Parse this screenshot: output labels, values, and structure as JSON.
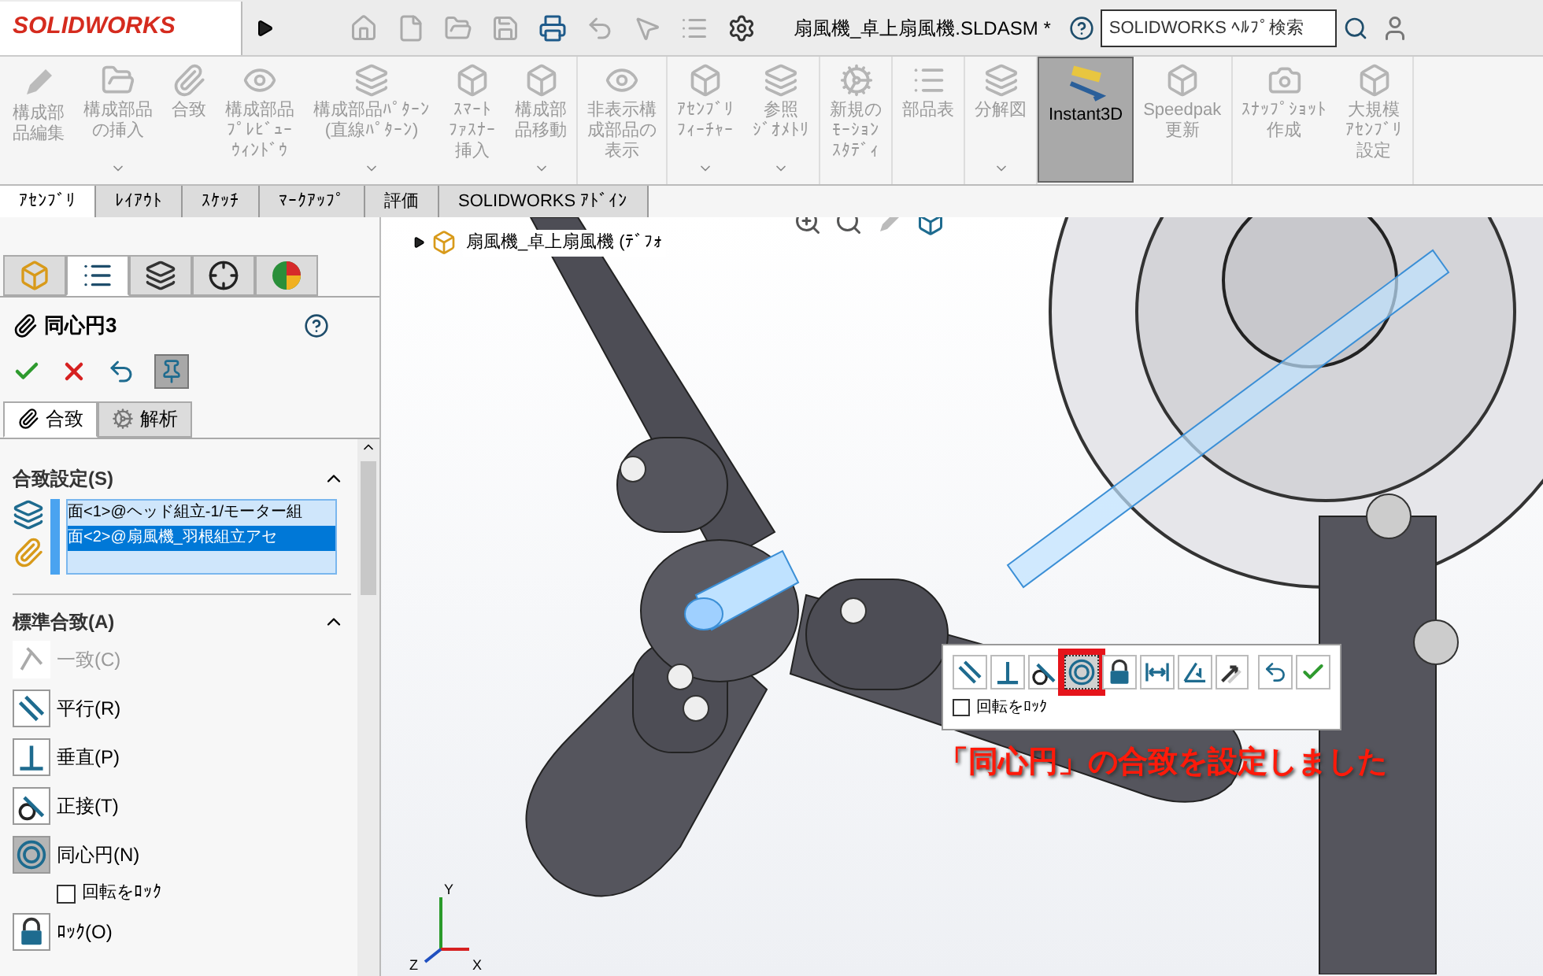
{
  "app_header": {
    "logo": "SOLIDWORKS",
    "title": "扇風機_卓上扇風機.SLDASM *",
    "search": {
      "placeholder": "SOLIDWORKS ﾍﾙﾌﾟ検索"
    }
  },
  "ribbon": {
    "groups": [
      [
        {
          "lines": [
            "構成部",
            "品編集"
          ],
          "disabled": true,
          "selected": false,
          "dropdown": false
        },
        {
          "lines": [
            "構成部品",
            "の挿入"
          ],
          "disabled": true,
          "selected": false,
          "dropdown": true
        },
        {
          "lines": [
            "合致"
          ],
          "disabled": true,
          "selected": false,
          "dropdown": false
        },
        {
          "lines": [
            "構成部品",
            "ﾌﾟﾚﾋﾞｭｰ",
            "ｳｨﾝﾄﾞｳ"
          ],
          "disabled": true,
          "selected": false,
          "dropdown": false
        },
        {
          "lines": [
            "構成部品ﾊﾟﾀｰﾝ",
            "(直線ﾊﾟﾀｰﾝ)"
          ],
          "disabled": true,
          "selected": false,
          "dropdown": true
        },
        {
          "lines": [
            "ｽﾏｰﾄ",
            "ﾌｧｽﾅｰ",
            "挿入"
          ],
          "disabled": true,
          "selected": false,
          "dropdown": false
        },
        {
          "lines": [
            "構成部",
            "品移動"
          ],
          "disabled": true,
          "selected": false,
          "dropdown": true
        }
      ],
      [
        {
          "lines": [
            "非表示構",
            "成部品の",
            "表示"
          ],
          "disabled": true,
          "selected": false,
          "dropdown": false
        }
      ],
      [
        {
          "lines": [
            "ｱｾﾝﾌﾞﾘ",
            "ﾌｨｰﾁｬｰ"
          ],
          "disabled": true,
          "selected": false,
          "dropdown": true
        },
        {
          "lines": [
            "参照",
            "ｼﾞｵﾒﾄﾘ"
          ],
          "disabled": true,
          "selected": false,
          "dropdown": true
        }
      ],
      [
        {
          "lines": [
            "新規の",
            "ﾓｰｼｮﾝ",
            "ｽﾀﾃﾞｨ"
          ],
          "disabled": true,
          "selected": false,
          "dropdown": false
        }
      ],
      [
        {
          "lines": [
            "部品表"
          ],
          "disabled": true,
          "selected": false,
          "dropdown": false
        }
      ],
      [
        {
          "lines": [
            "分解図"
          ],
          "disabled": true,
          "selected": false,
          "dropdown": true
        }
      ],
      [
        {
          "lines": [
            "Instant3D"
          ],
          "disabled": false,
          "selected": true,
          "dropdown": false
        },
        {
          "lines": [
            "Speedpak",
            "更新"
          ],
          "disabled": true,
          "selected": false,
          "dropdown": false
        }
      ],
      [
        {
          "lines": [
            "ｽﾅｯﾌﾟｼｮｯﾄ",
            "作成"
          ],
          "disabled": true,
          "selected": false,
          "dropdown": false
        },
        {
          "lines": [
            "大規模",
            "ｱｾﾝﾌﾞﾘ",
            "設定"
          ],
          "disabled": true,
          "selected": false,
          "dropdown": false
        }
      ]
    ]
  },
  "tabs": [
    {
      "label": "ｱｾﾝﾌﾞﾘ",
      "selected": true
    },
    {
      "label": "ﾚｲｱｳﾄ",
      "selected": false
    },
    {
      "label": "ｽｹｯﾁ",
      "selected": false
    },
    {
      "label": "ﾏｰｸｱｯﾌﾟ",
      "selected": false
    },
    {
      "label": "評価",
      "selected": false
    },
    {
      "label": "SOLIDWORKS ｱﾄﾞｲﾝ",
      "selected": false
    }
  ],
  "panel": {
    "manager_tabs": [
      {
        "kind": "tree",
        "selected": false
      },
      {
        "kind": "property",
        "selected": true
      },
      {
        "kind": "config",
        "selected": false
      },
      {
        "kind": "dimxpert",
        "selected": false
      },
      {
        "kind": "display",
        "selected": false
      }
    ],
    "title": "同心円3",
    "pin": {
      "on": true
    },
    "subtabs": [
      {
        "label": "合致",
        "kind": "mates",
        "selected": true
      },
      {
        "label": "解析",
        "kind": "analysis",
        "selected": false
      }
    ],
    "mate_selections": {
      "title": "合致設定(S)",
      "expanded": true,
      "items": [
        {
          "text": "面<1>@ヘッド組立-1/モーター組",
          "selected": false
        },
        {
          "text": "面<2>@扇風機_羽根組立アセ",
          "selected": true
        }
      ]
    },
    "standard_mates": {
      "title": "標準合致(A)",
      "expanded": true,
      "items": [
        {
          "kind": "coincident",
          "label": "一致(C)",
          "disabled": true,
          "selected": false
        },
        {
          "kind": "parallel",
          "label": "平行(R)",
          "disabled": false,
          "selected": false
        },
        {
          "kind": "perpendicular",
          "label": "垂直(P)",
          "disabled": false,
          "selected": false
        },
        {
          "kind": "tangent",
          "label": "正接(T)",
          "disabled": false,
          "selected": false
        },
        {
          "kind": "concentric",
          "label": "同心円(N)",
          "disabled": false,
          "selected": true
        },
        {
          "kind": "checkbox",
          "label": "回転をﾛｯｸ",
          "checked": false
        },
        {
          "kind": "lock",
          "label": "ﾛｯｸ(O)",
          "disabled": false,
          "selected": false
        }
      ]
    }
  },
  "viewport": {
    "tree_root": "扇風機_卓上扇風機 (ﾃﾞﾌｫ",
    "mate_popup": {
      "buttons": [
        {
          "kind": "parallel",
          "selected": false
        },
        {
          "kind": "perpendicular",
          "selected": false
        },
        {
          "kind": "tangent",
          "selected": false
        },
        {
          "kind": "concentric",
          "selected": true
        },
        {
          "kind": "lock",
          "selected": false
        },
        {
          "kind": "distance",
          "selected": false
        },
        {
          "kind": "angle",
          "selected": false
        },
        {
          "kind": "flip",
          "selected": false
        },
        {
          "kind": "undo",
          "selected": false
        },
        {
          "kind": "ok",
          "selected": false
        }
      ],
      "lock_rotation": {
        "label": "回転をﾛｯｸ",
        "checked": false
      }
    },
    "annotation": "「同心円」の合致を設定しました",
    "triad": {
      "x": "X",
      "y": "Y",
      "z": "Z"
    }
  }
}
